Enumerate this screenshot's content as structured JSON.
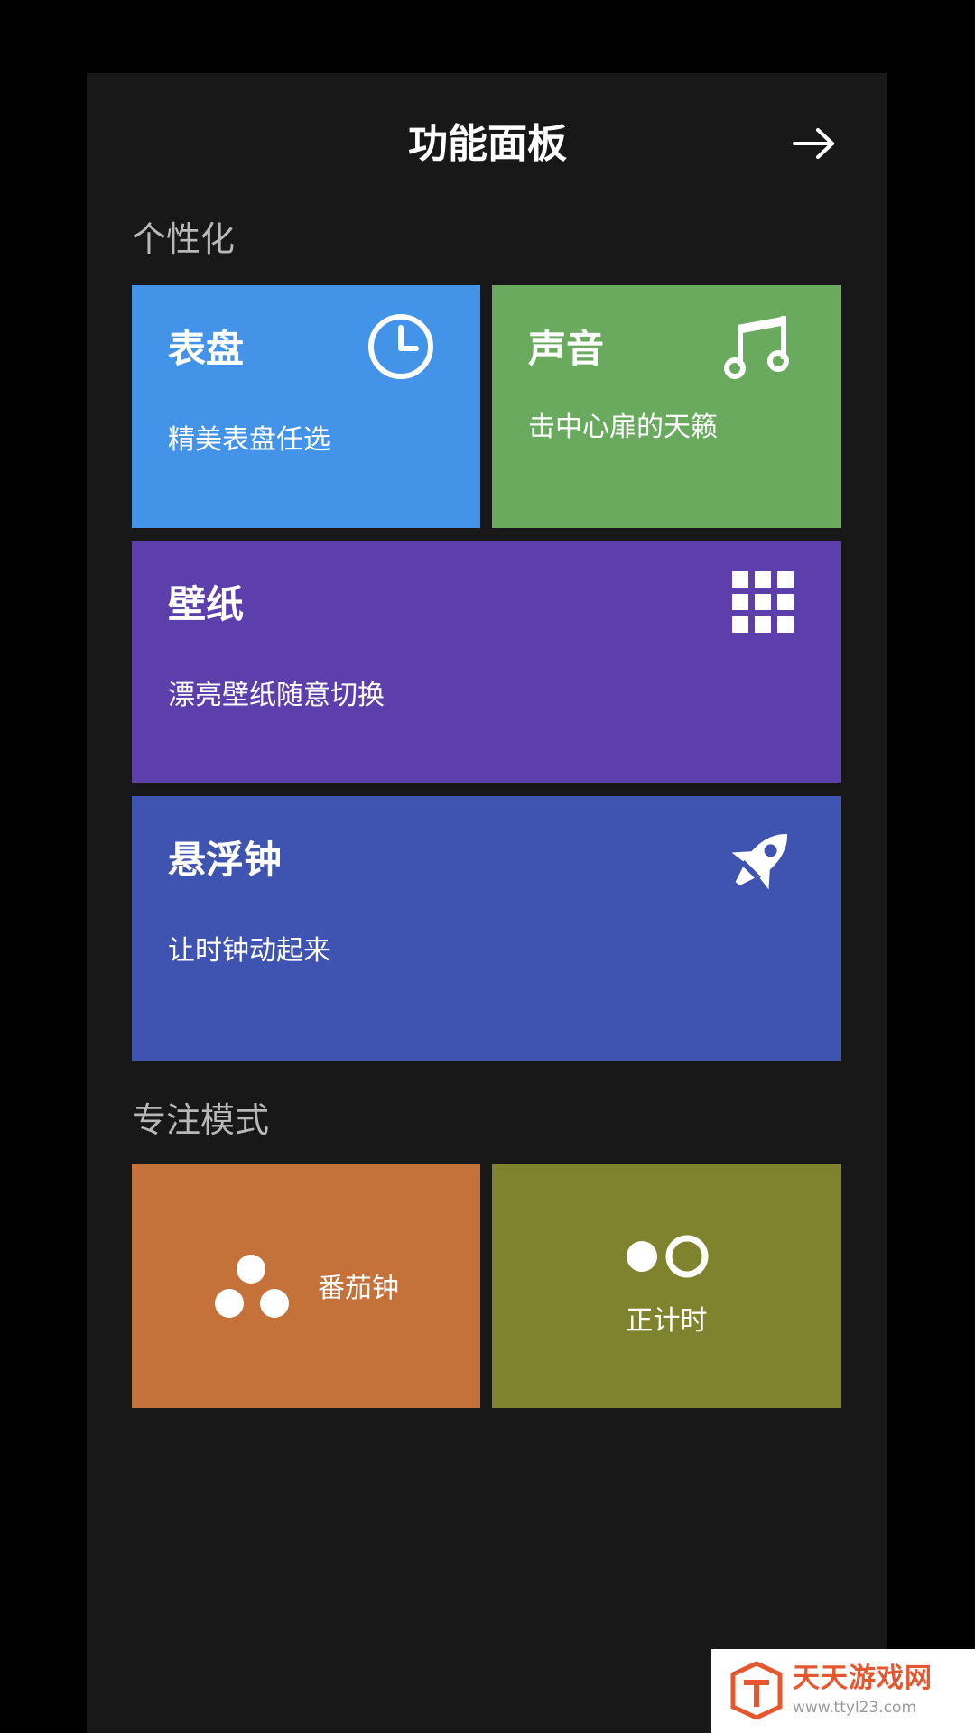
{
  "header": {
    "title": "功能面板",
    "next_icon": "arrow-right-icon"
  },
  "sections": {
    "personalize": "个性化",
    "focus": "专注模式"
  },
  "tiles": {
    "dial": {
      "title": "表盘",
      "subtitle": "精美表盘任选",
      "icon": "clock-icon",
      "color": "#4393e8"
    },
    "sound": {
      "title": "声音",
      "subtitle": "击中心扉的天籁",
      "icon": "music-note-icon",
      "color": "#69aa5e"
    },
    "wallpaper": {
      "title": "壁纸",
      "subtitle": "漂亮壁纸随意切换",
      "icon": "grid-icon",
      "color": "#5d3fab"
    },
    "floating": {
      "title": "悬浮钟",
      "subtitle": "让时钟动起来",
      "icon": "rocket-icon",
      "color": "#3f53b0"
    },
    "pomodoro": {
      "label": "番茄钟",
      "icon": "three-dots-icon",
      "color": "#c4713a"
    },
    "stopwatch": {
      "label": "正计时",
      "icon": "dot-ring-icon",
      "color": "#80832e"
    }
  },
  "watermark": {
    "name": "天天游戏网",
    "url": "www.ttyl23.com",
    "logo_icon": "site-logo-icon",
    "color": "#e5572f"
  }
}
